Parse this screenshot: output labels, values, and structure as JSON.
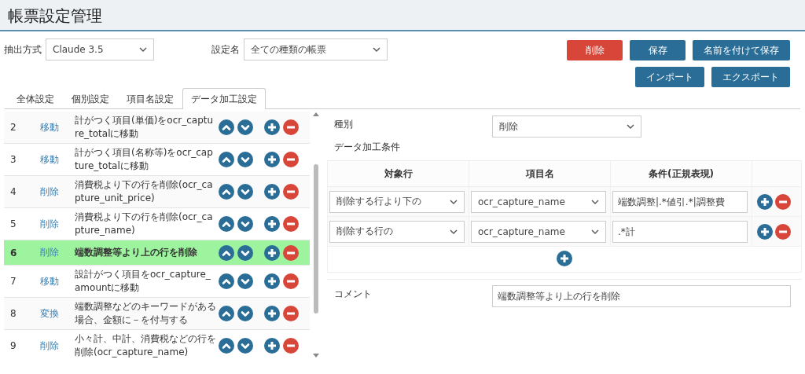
{
  "title": "帳票設定管理",
  "filters": [
    {
      "label": "抽出方式",
      "value": "Claude 3.5"
    },
    {
      "label": "設定名",
      "value": "全ての種類の帳票"
    }
  ],
  "actions_top": [
    {
      "label": "削除",
      "kind": "danger"
    },
    {
      "label": "保存",
      "kind": "primary"
    },
    {
      "label": "名前を付けて保存",
      "kind": "primary"
    }
  ],
  "actions_bottom": [
    {
      "label": "インポート",
      "kind": "primary"
    },
    {
      "label": "エクスポート",
      "kind": "primary"
    }
  ],
  "tabs": [
    {
      "label": "全体設定",
      "selected": false
    },
    {
      "label": "個別設定",
      "selected": false
    },
    {
      "label": "項目名設定",
      "selected": false
    },
    {
      "label": "データ加工設定",
      "selected": true
    }
  ],
  "rules": [
    {
      "no": "2",
      "type": "移動",
      "description": "計がつく項目(単価)をocr_capture_totalに移動",
      "selected": false
    },
    {
      "no": "3",
      "type": "移動",
      "description": "計がつく項目(名称等)をocr_capture_totalに移動",
      "selected": false
    },
    {
      "no": "4",
      "type": "削除",
      "description": "消費税より下の行を削除(ocr_capture_unit_price)",
      "selected": false
    },
    {
      "no": "5",
      "type": "削除",
      "description": "消費税より下の行を削除(ocr_capture_name)",
      "selected": false
    },
    {
      "no": "6",
      "type": "削除",
      "description": "端数調整等より上の行を削除",
      "selected": true
    },
    {
      "no": "7",
      "type": "移動",
      "description": "設計がつく項目をocr_capture_amountに移動",
      "selected": false
    },
    {
      "no": "8",
      "type": "変換",
      "description": "端数調整などのキーワードがある場合、金額に－を付与する",
      "selected": false
    },
    {
      "no": "9",
      "type": "削除",
      "description": "小々計、中計、消費税などの行を削除(ocr_capture_name)",
      "selected": false
    }
  ],
  "detail": {
    "type_label": "種別",
    "type_value": "削除",
    "conditions_label": "データ加工条件",
    "columns": [
      "対象行",
      "項目名",
      "条件(正規表現)"
    ],
    "conditions": [
      {
        "target": "削除する行より下の",
        "item": "ocr_capture_name",
        "pattern": "端数調整|.*値引.*|調整費"
      },
      {
        "target": "削除する行の",
        "item": "ocr_capture_name",
        "pattern": ".*計"
      }
    ],
    "comment_label": "コメント",
    "comment": "端数調整等より上の行を削除"
  }
}
